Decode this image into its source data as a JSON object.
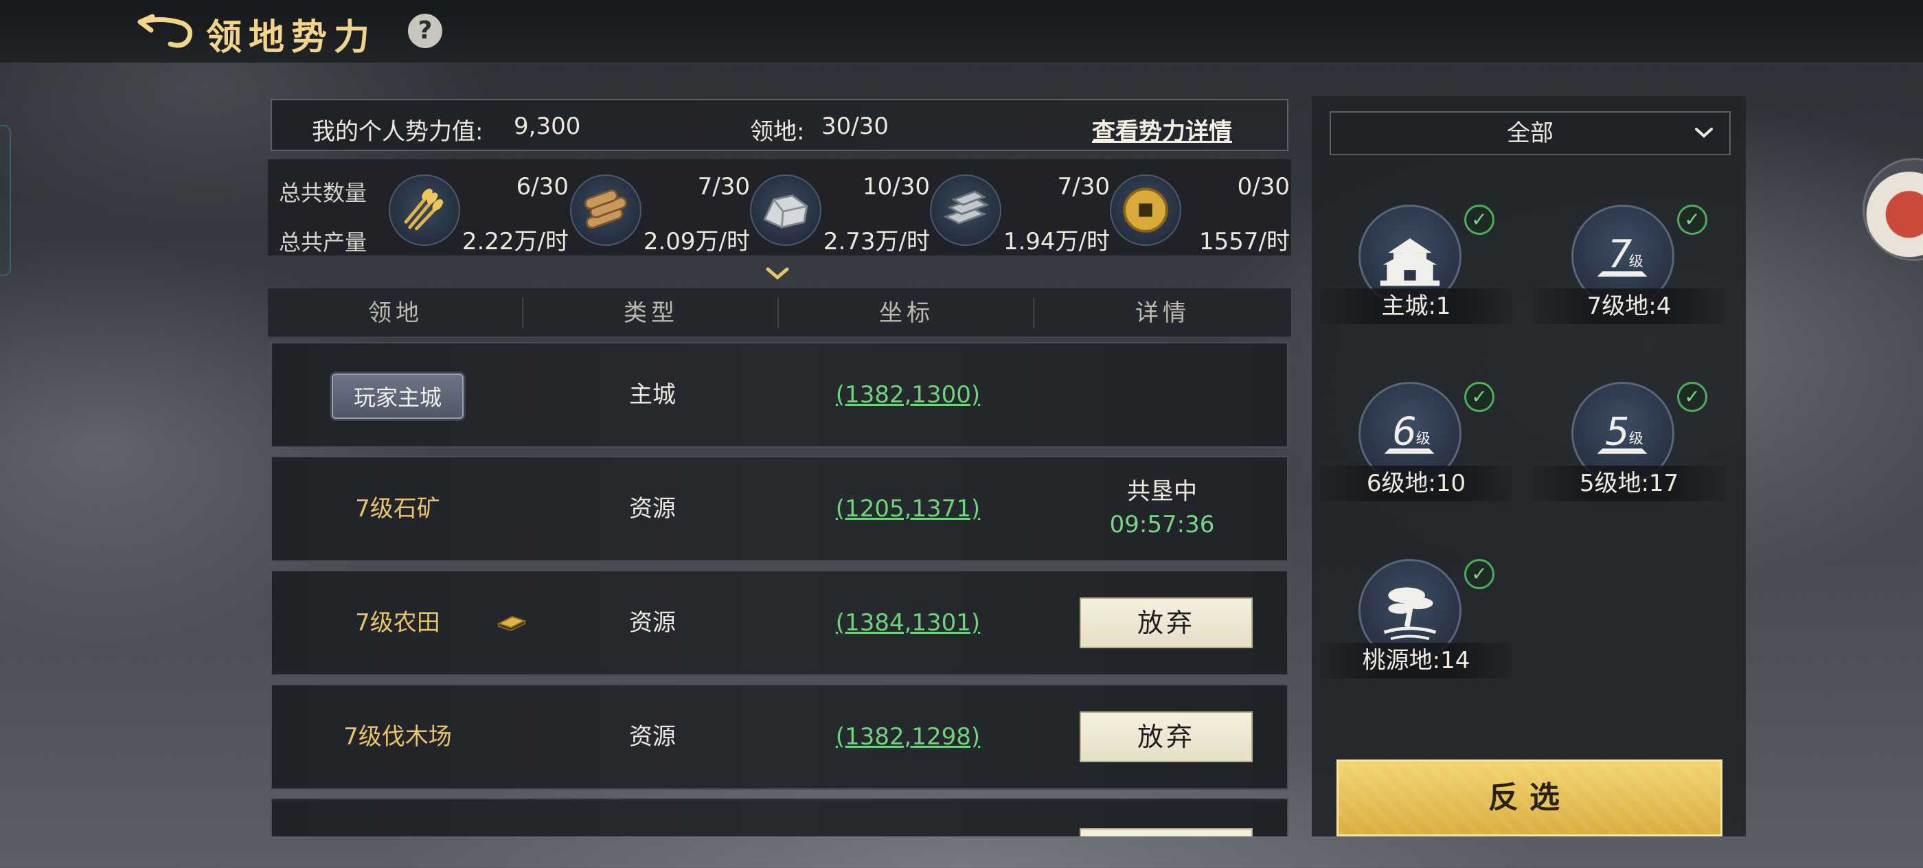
{
  "header": {
    "title": "领地势力",
    "help_label": "?"
  },
  "summary": {
    "power_label": "我的个人势力值:",
    "power_value": "9,300",
    "territory_label": "领地:",
    "territory_value": "30/30",
    "detail_link": "查看势力详情"
  },
  "stats": {
    "count_label": "总共数量",
    "rate_label": "总共产量",
    "resources": [
      {
        "icon": "grain-icon",
        "count": "6/30",
        "rate": "2.22万/时"
      },
      {
        "icon": "wood-icon",
        "count": "7/30",
        "rate": "2.09万/时"
      },
      {
        "icon": "stone-icon",
        "count": "10/30",
        "rate": "2.73万/时"
      },
      {
        "icon": "iron-icon",
        "count": "7/30",
        "rate": "1.94万/时"
      },
      {
        "icon": "coin-icon",
        "count": "0/30",
        "rate": "1557/时"
      }
    ]
  },
  "table": {
    "headers": [
      "领地",
      "类型",
      "坐标",
      "详情"
    ],
    "rows": [
      {
        "name": "玩家主城",
        "type": "主城",
        "coord": "(1382,1300)",
        "detail": ""
      },
      {
        "name": "7级石矿",
        "type": "资源",
        "coord": "(1205,1371)",
        "status": "共垦中",
        "timer": "09:57:36"
      },
      {
        "name": "7级农田",
        "type": "资源",
        "coord": "(1384,1301)",
        "action": "放弃"
      },
      {
        "name": "7级伐木场",
        "type": "资源",
        "coord": "(1382,1298)",
        "action": "放弃"
      }
    ]
  },
  "filter": {
    "selected": "全部",
    "items": [
      {
        "label": "主城:1",
        "icon": "main-city-icon",
        "checked": true
      },
      {
        "label": "7级地:4",
        "icon": "level-7-land-icon",
        "checked": true
      },
      {
        "label": "6级地:10",
        "icon": "level-6-land-icon",
        "checked": true
      },
      {
        "label": "5级地:17",
        "icon": "level-5-land-icon",
        "checked": true
      },
      {
        "label": "桃源地:14",
        "icon": "peach-land-icon",
        "checked": true
      }
    ],
    "invert_label": "反选",
    "check_mark": "✓"
  },
  "icon_glyphs": {
    "level7": "7",
    "level6": "6",
    "level5": "5",
    "level_suffix": "级"
  }
}
